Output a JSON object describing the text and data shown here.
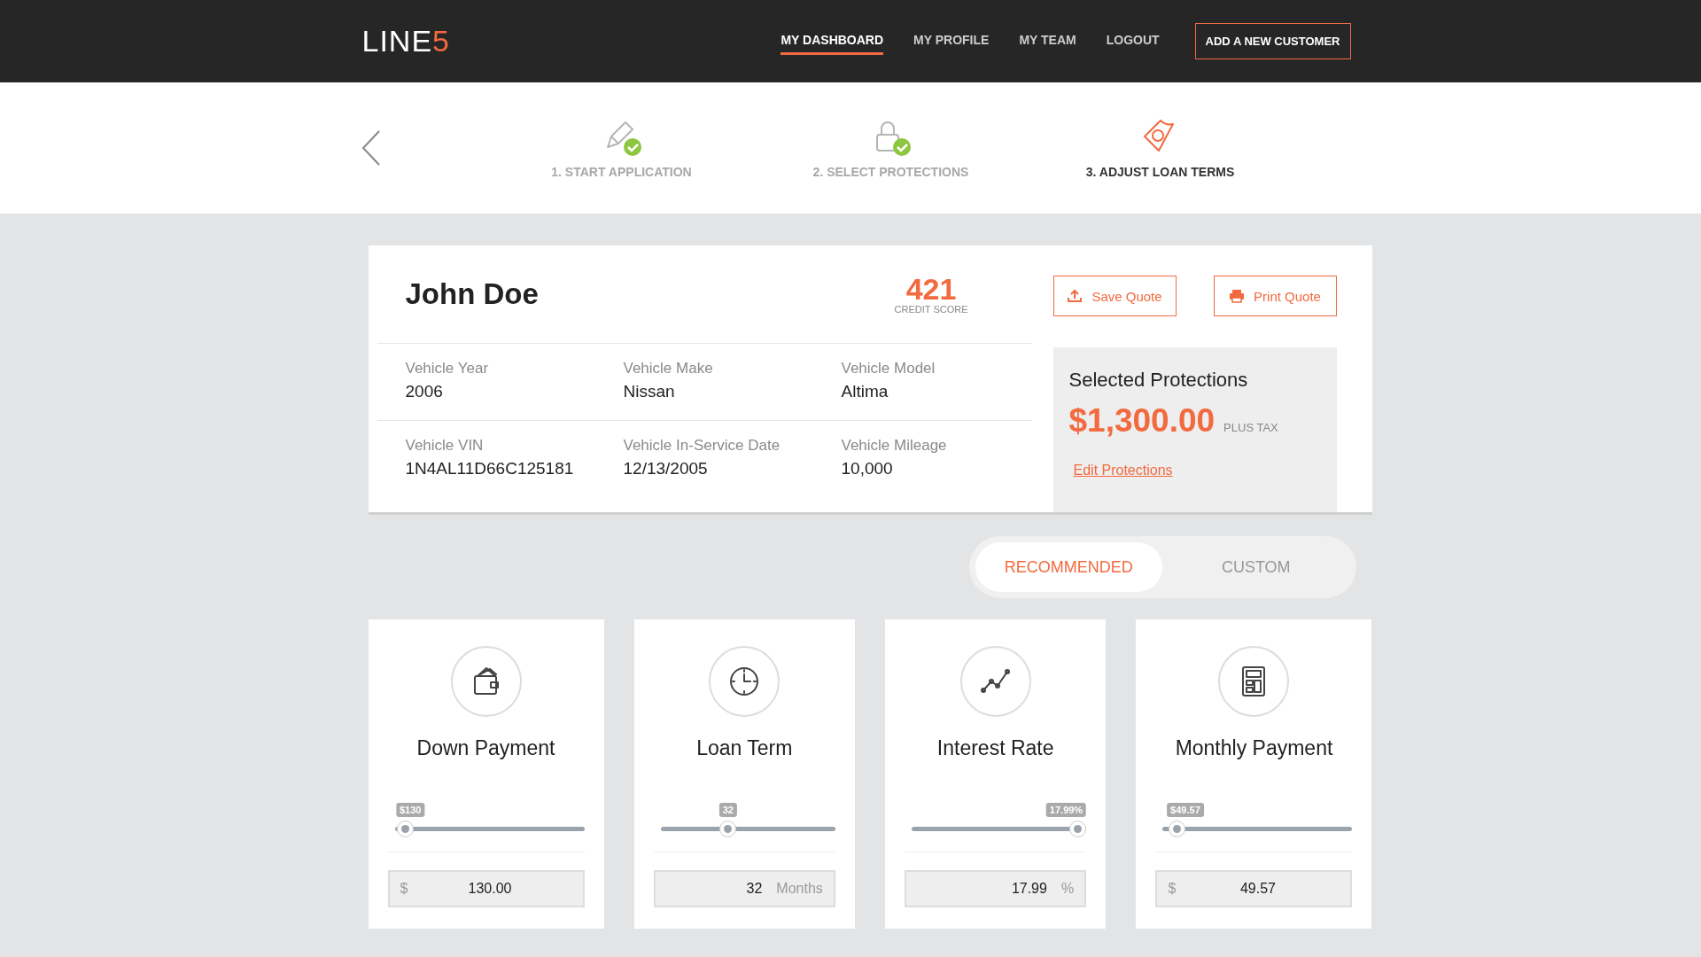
{
  "header": {
    "logo": {
      "text": "LINE",
      "accent": "5"
    },
    "nav": [
      {
        "label": "MY DASHBOARD",
        "selected": true
      },
      {
        "label": "MY PROFILE",
        "selected": false
      },
      {
        "label": "MY TEAM",
        "selected": false
      },
      {
        "label": "LOGOUT",
        "selected": false
      }
    ],
    "cta": "ADD A NEW CUSTOMER"
  },
  "steps": [
    {
      "label": "1. START APPLICATION",
      "completed": true,
      "selected": false
    },
    {
      "label": "2. SELECT PROTECTIONS",
      "completed": true,
      "selected": false
    },
    {
      "label": "3. ADJUST LOAN TERMS",
      "completed": false,
      "selected": true
    }
  ],
  "customer": {
    "name": "John Doe",
    "credit_score": "421",
    "credit_label": "CREDIT SCORE",
    "buttons": [
      "Save Quote",
      "Print Quote"
    ],
    "fields": [
      [
        {
          "label": "Vehicle Year",
          "value": "2006"
        },
        {
          "label": "Vehicle Make",
          "value": "Nissan"
        },
        {
          "label": "Vehicle Model",
          "value": "Altima"
        }
      ],
      [
        {
          "label": "Vehicle VIN",
          "value": "1N4AL11D66C125181"
        },
        {
          "label": "Vehicle In-Service Date",
          "value": "12/13/2005"
        },
        {
          "label": "Vehicle Mileage",
          "value": "10,000"
        }
      ]
    ],
    "protections": {
      "title": "Selected Protections",
      "amount": "$1,300.00",
      "tax": "PLUS TAX",
      "link": "Edit Protections"
    }
  },
  "mode_toggle": [
    {
      "label": "RECOMMENDED",
      "selected": true
    },
    {
      "label": "CUSTOM",
      "selected": false
    }
  ],
  "terms": [
    {
      "title": "Down Payment",
      "bubble": "$130",
      "level": 0.05,
      "kind": "prefix",
      "unit": "$",
      "value": "130.00"
    },
    {
      "title": "Loan Term",
      "bubble": "32",
      "level": 0.4,
      "kind": "suffix",
      "unit": "Months",
      "value": "32"
    },
    {
      "title": "Interest Rate",
      "bubble": "17.99%",
      "level": 1,
      "kind": "suffix",
      "unit": "%",
      "value": "17.99"
    },
    {
      "title": "Monthly Payment",
      "bubble": "$49.57",
      "level": 0.07,
      "kind": "prefix",
      "unit": "$",
      "value": "49.57"
    }
  ]
}
